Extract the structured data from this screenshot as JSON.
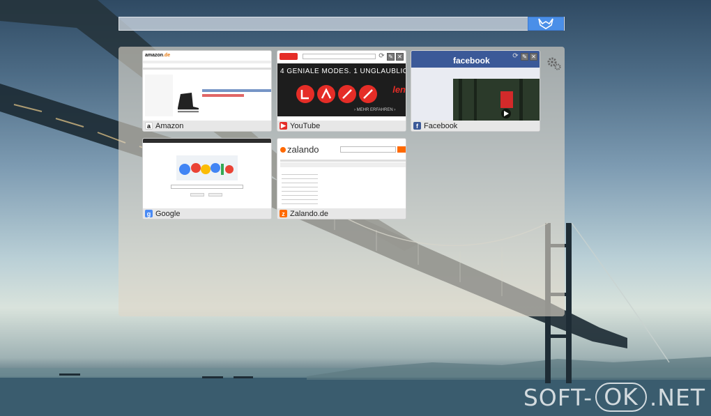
{
  "search": {
    "placeholder": "",
    "value": ""
  },
  "tiles": [
    {
      "label": "Amazon",
      "fav": "a",
      "fav_color": "#000000"
    },
    {
      "label": "YouTube",
      "fav": "▶",
      "fav_color": "#e52d27",
      "promo": "4 GENIALE MODES. 1 UNGLAUBLIC",
      "cta": "› MEHR ERFAHREN ›",
      "brand": "len"
    },
    {
      "label": "Facebook",
      "fav": "f",
      "fav_color": "#3b5998",
      "header": "facebook"
    },
    {
      "label": "Google",
      "fav": "g",
      "fav_color": "#4a8af4"
    },
    {
      "label": "Zalando.de",
      "fav": "z",
      "fav_color": "#ff6900",
      "brand": "zalando"
    }
  ],
  "tile_tools": {
    "refresh": "⟳",
    "edit": "✎",
    "close": "✕"
  },
  "watermark": {
    "left": "SOFT-",
    "mid": "OK",
    "right": ".NET"
  },
  "colors": {
    "accent": "#4a8fe8",
    "panel": "#ded6c8",
    "youtube": "#e52d27",
    "facebook": "#3b5998",
    "zalando": "#ff6900"
  }
}
